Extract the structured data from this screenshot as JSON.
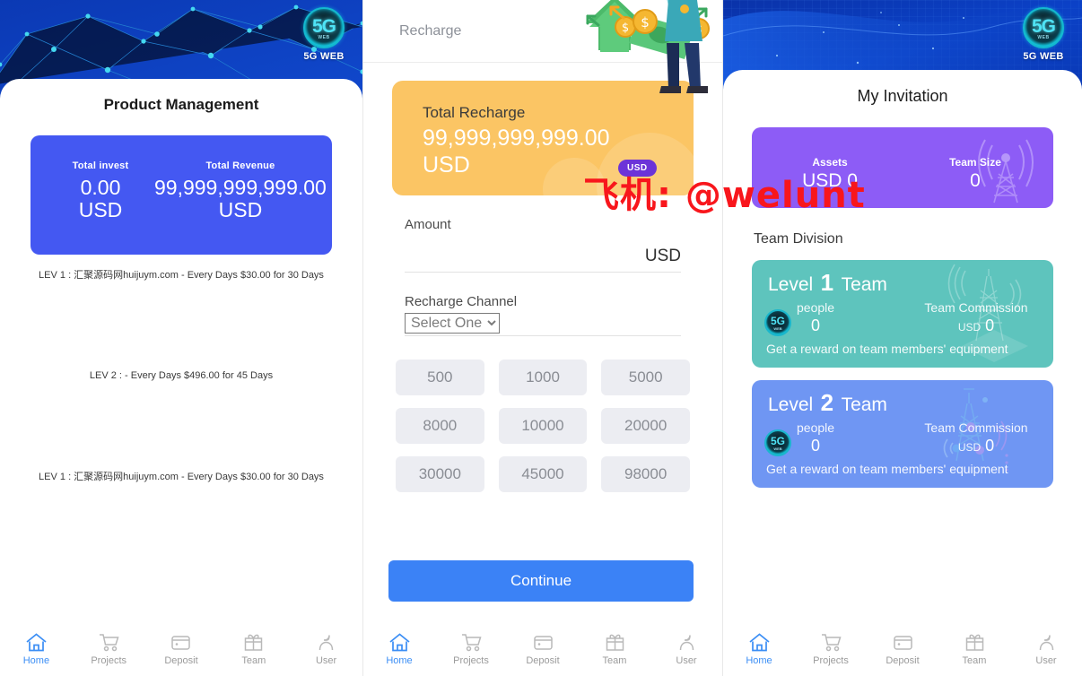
{
  "colors": {
    "banner_blue": "#0f3fbe",
    "card_blue": "#4458f2",
    "card_orange": "#fbc564",
    "card_purple": "#8d5cf6",
    "team1_teal": "#5ec4bd",
    "team2_blue": "#6f96f3",
    "accent_blue": "#3b82f6",
    "watermark_red": "#f8161c"
  },
  "watermark": {
    "text": "飞机: @welunt"
  },
  "brand": {
    "mark": "5G",
    "mark_sub": "WEB",
    "caption": "5G WEB"
  },
  "left": {
    "title": "Product Management",
    "stats": [
      {
        "label": "Total invest",
        "value": "0.00",
        "currency": "USD"
      },
      {
        "label": "Total Revenue",
        "value": "99,999,999,999.00",
        "currency": "USD"
      }
    ],
    "levels": [
      "LEV 1 : 汇聚源码网huijuym.com - Every Days $30.00 for 30 Days",
      "LEV 2 : - Every Days $496.00 for 45 Days",
      "LEV 1 : 汇聚源码网huijuym.com - Every Days $30.00 for 30 Days"
    ]
  },
  "middle": {
    "header_title": "Recharge",
    "total": {
      "label": "Total Recharge",
      "amount": "99,999,999,999.00",
      "currency": "USD"
    },
    "usd_pill": "USD",
    "amount": {
      "label": "Amount",
      "value": "",
      "placeholder": "",
      "currency": "USD"
    },
    "channel": {
      "label": "Recharge Channel",
      "selected": "Select One",
      "options": [
        "Select One"
      ]
    },
    "quick_amounts": [
      "500",
      "1000",
      "5000",
      "8000",
      "10000",
      "20000",
      "30000",
      "45000",
      "98000"
    ],
    "continue_label": "Continue"
  },
  "right": {
    "title": "My Invitation",
    "invite": [
      {
        "label": "Assets",
        "value": "USD 0"
      },
      {
        "label": "Team Size",
        "value": "0"
      }
    ],
    "section_title": "Team Division",
    "teams": [
      {
        "level_word": "Level",
        "level_num": "1",
        "team_word": "Team",
        "people_label": "people",
        "people_value": "0",
        "commission_label": "Team Commission",
        "commission_unit": "USD",
        "commission_value": "0",
        "footer": "Get a reward on team members' equipment"
      },
      {
        "level_word": "Level",
        "level_num": "2",
        "team_word": "Team",
        "people_label": "people",
        "people_value": "0",
        "commission_label": "Team Commission",
        "commission_unit": "USD",
        "commission_value": "0",
        "footer": "Get a reward on team members' equipment"
      }
    ]
  },
  "nav": {
    "items": [
      {
        "label": "Home",
        "icon": "home-icon",
        "active": true
      },
      {
        "label": "Projects",
        "icon": "cart-icon",
        "active": false
      },
      {
        "label": "Deposit",
        "icon": "wallet-icon",
        "active": false
      },
      {
        "label": "Team",
        "icon": "gift-icon",
        "active": false
      },
      {
        "label": "User",
        "icon": "user-icon",
        "active": false
      }
    ]
  }
}
